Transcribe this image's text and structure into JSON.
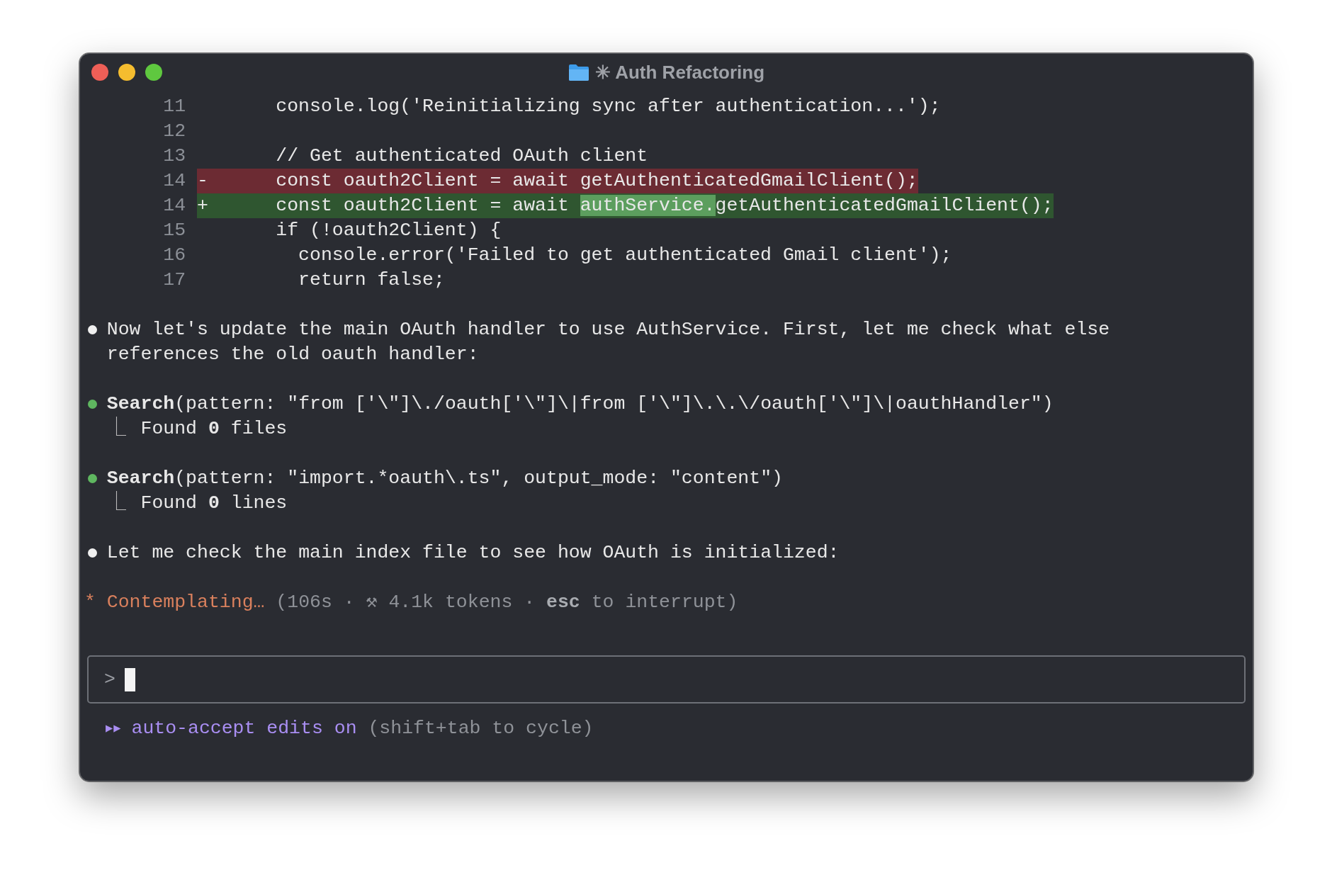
{
  "window": {
    "title": "✳ Auth Refactoring"
  },
  "diff": {
    "lines": [
      {
        "number": "11",
        "kind": "context",
        "segments": [
          {
            "text": "console.log('Reinitializing sync after authentication...');",
            "emphasis": false
          }
        ]
      },
      {
        "number": "12",
        "kind": "context"
      },
      {
        "number": "13",
        "kind": "context",
        "segments": [
          {
            "text": "// Get authenticated OAuth client",
            "emphasis": false
          }
        ]
      },
      {
        "number": "14",
        "kind": "removed",
        "marker": "-",
        "segments": [
          {
            "text": "const oauth2Client = await getAuthenticatedGmailClient();",
            "emphasis": false
          }
        ]
      },
      {
        "number": "14",
        "kind": "added",
        "marker": "+",
        "segments": [
          {
            "text": "const oauth2Client = await ",
            "emphasis": false
          },
          {
            "text": "authService.",
            "emphasis": true
          },
          {
            "text": "getAuthenticatedGmailClient();",
            "emphasis": false
          }
        ]
      },
      {
        "number": "15",
        "kind": "context",
        "segments": [
          {
            "text": "if (!oauth2Client) {",
            "emphasis": false
          }
        ]
      },
      {
        "number": "16",
        "kind": "context",
        "segments": [
          {
            "text": "  console.error('Failed to get authenticated Gmail client');",
            "emphasis": false
          }
        ]
      },
      {
        "number": "17",
        "kind": "context",
        "segments": [
          {
            "text": "  return false;",
            "emphasis": false
          }
        ]
      }
    ]
  },
  "messages": [
    {
      "kind": "text",
      "text": "Now let's update the main OAuth handler to use AuthService. First, let me check what else references the old oauth handler:"
    },
    {
      "kind": "tool",
      "tool": "Search",
      "args": "(pattern: \"from ['\\\"]\\./oauth['\\\"]\\|from ['\\\"]\\.\\.\\/oauth['\\\"]\\|oauthHandler\")",
      "result_prefix": "⎿",
      "result": "Found **0** files"
    },
    {
      "kind": "tool",
      "tool": "Search",
      "args": "(pattern: \"import.*oauth\\.ts\", output_mode: \"content\")",
      "result_prefix": "⎿",
      "result": "Found **0** lines"
    },
    {
      "kind": "text",
      "text": "Let me check the main index file to see how OAuth is initialized:"
    }
  ],
  "status": {
    "glyph": "*",
    "label": "Contemplating…",
    "detail": "(106s · ⚒ 4.1k tokens · **esc** to interrupt)"
  },
  "input": {
    "prompt": ">"
  },
  "footer": {
    "glyph": "▶▶",
    "mode": "auto-accept edits on",
    "hint": "(shift+tab to cycle)"
  }
}
